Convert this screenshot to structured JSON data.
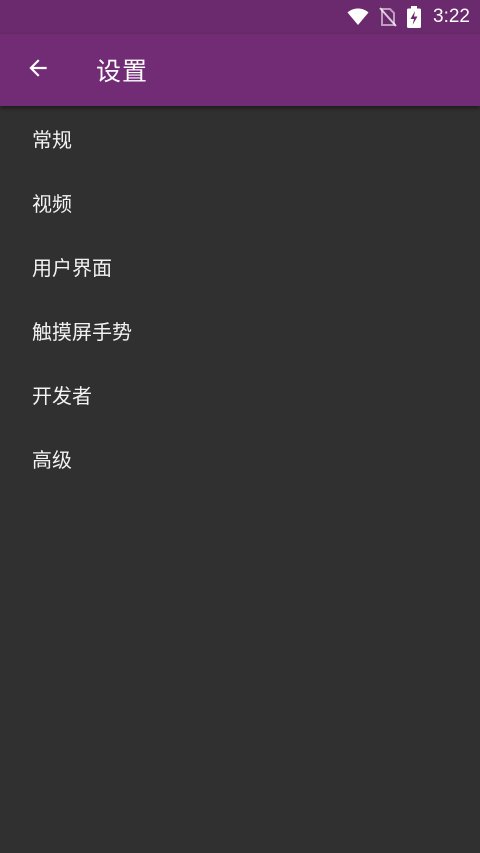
{
  "status_bar": {
    "time": "3:22",
    "icons": [
      "wifi-icon",
      "no-sim-icon",
      "battery-charging-icon"
    ]
  },
  "app_bar": {
    "back_icon": "arrow-left-icon",
    "title": "设置"
  },
  "colors": {
    "status_bar": "#6a2a6d",
    "app_bar": "#722c76",
    "background": "#303030",
    "text": "#ffffff"
  },
  "settings": {
    "items": [
      {
        "label": "常规"
      },
      {
        "label": "视频"
      },
      {
        "label": "用户界面"
      },
      {
        "label": "触摸屏手势"
      },
      {
        "label": "开发者"
      },
      {
        "label": "高级"
      }
    ]
  }
}
